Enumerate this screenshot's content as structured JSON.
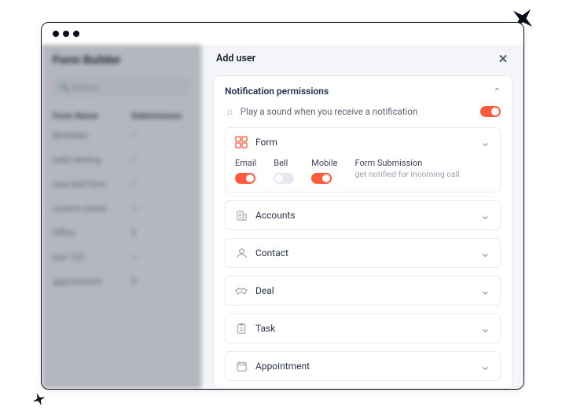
{
  "background": {
    "title": "Form Builder",
    "search_placeholder": "Search",
    "columns": {
      "name": "Form Name",
      "subs": "Submissions"
    },
    "rows": [
      {
        "name": "Birthdate",
        "subs": "—"
      },
      {
        "name": "radio testing",
        "subs": "—"
      },
      {
        "name": "new test form",
        "subs": "—"
      },
      {
        "name": "custom check",
        "subs": "—"
      },
      {
        "name": "Office",
        "subs": "2"
      },
      {
        "name": "test 123",
        "subs": "—"
      },
      {
        "name": "appointment",
        "subs": "3"
      }
    ]
  },
  "panel": {
    "title": "Add user",
    "section_title": "Notification permissions",
    "sound_label": "Play a sound when you receive a notification",
    "sound_on": true
  },
  "form_block": {
    "title": "Form",
    "email_label": "Email",
    "bell_label": "Bell",
    "mobile_label": "Mobile",
    "sub_label": "Form Submission",
    "sub_desc": "get notified for incoming call",
    "email_on": true,
    "bell_on": false,
    "mobile_on": true
  },
  "categories": {
    "accounts": "Accounts",
    "contact": "Contact",
    "deal": "Deal",
    "task": "Task",
    "appointment": "Appointment"
  }
}
